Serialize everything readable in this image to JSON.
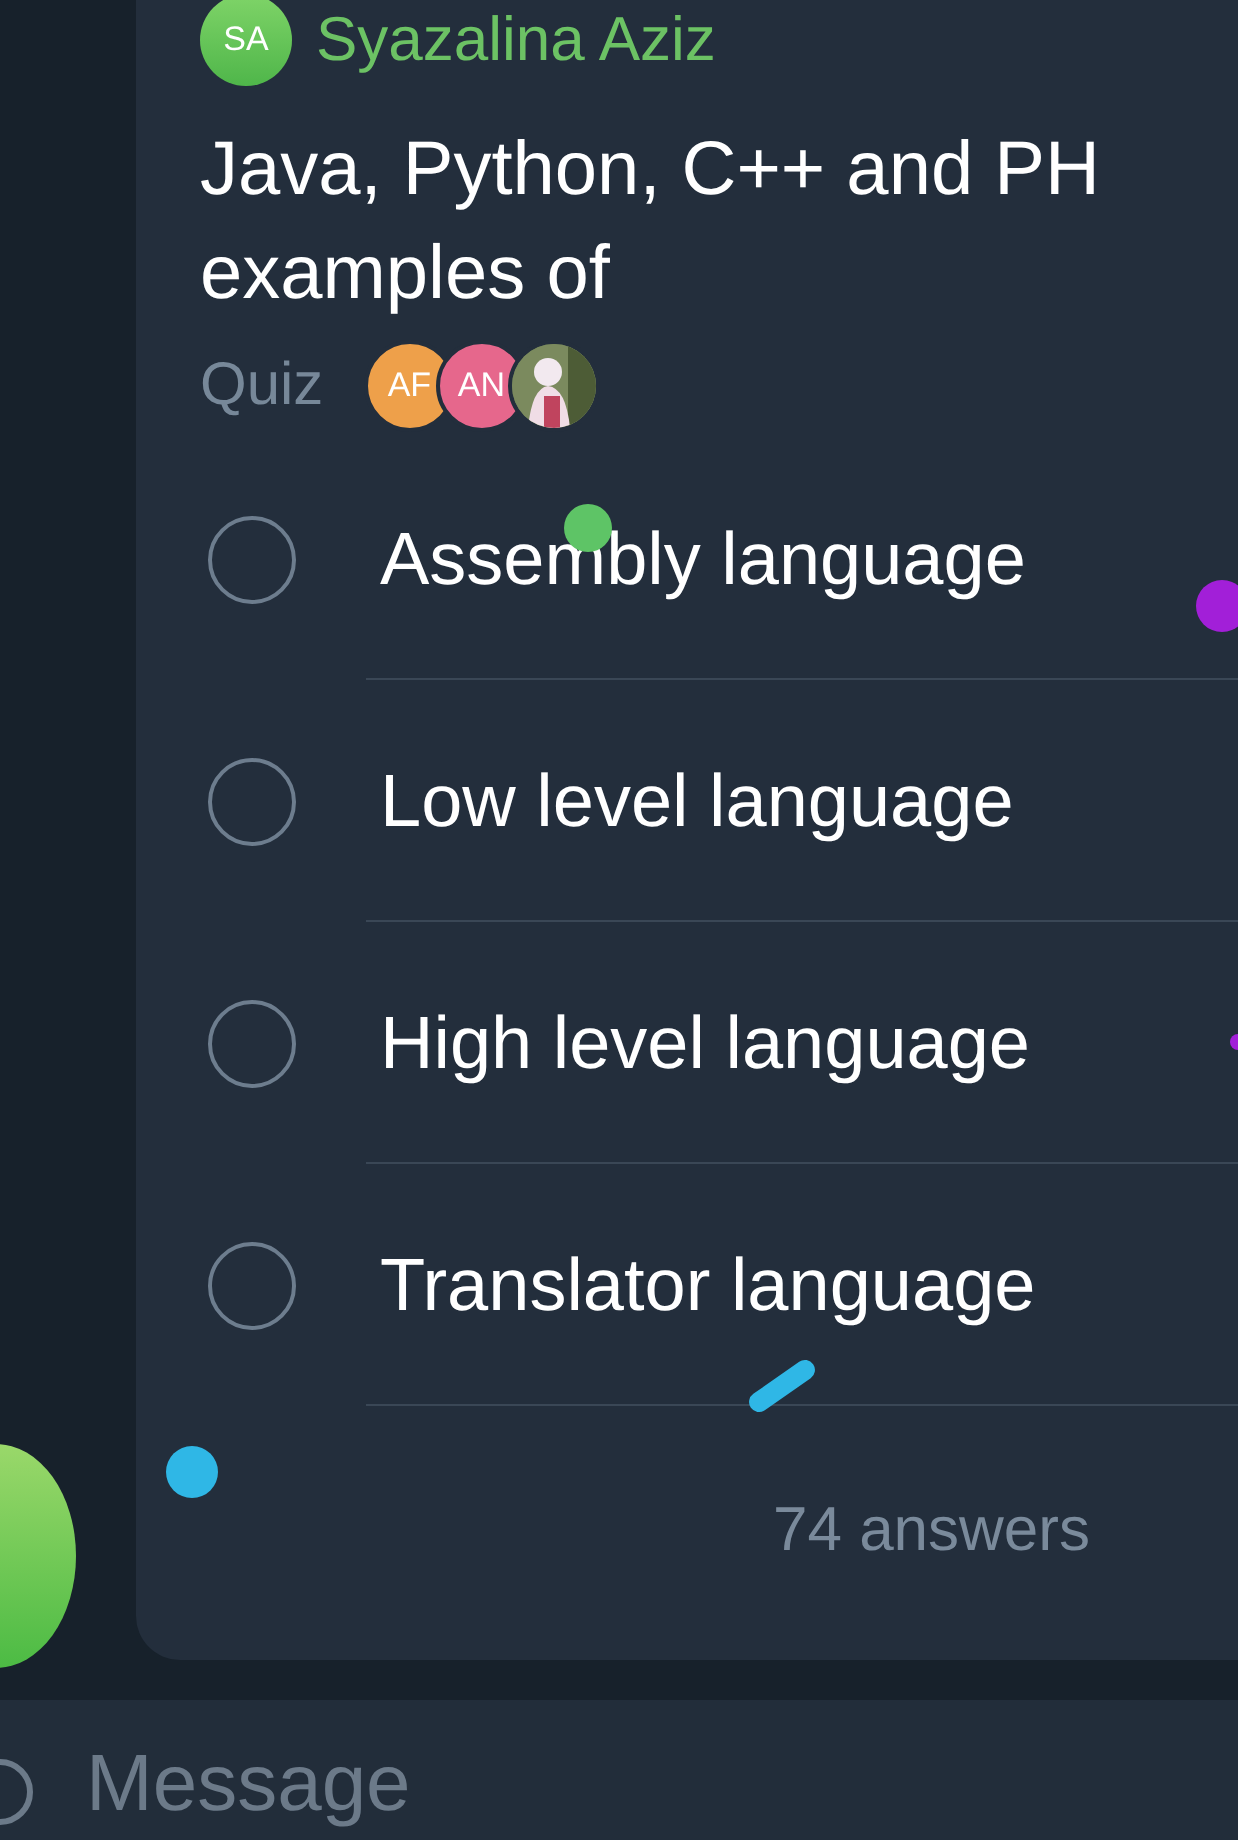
{
  "sender": {
    "initials": "SA",
    "name": "Syazalina Aziz"
  },
  "question": "Java, Python, C++ and PH examples of",
  "poll_type": "Quiz",
  "voters": [
    {
      "kind": "initials",
      "initials": "AF",
      "color": "#eea04a"
    },
    {
      "kind": "initials",
      "initials": "AN",
      "color": "#e6678c"
    },
    {
      "kind": "picture"
    }
  ],
  "options": [
    {
      "text": "Assembly language",
      "selected": false
    },
    {
      "text": "Low level language",
      "selected": false
    },
    {
      "text": "High level language",
      "selected": false
    },
    {
      "text": "Translator language",
      "selected": false
    }
  ],
  "answers": "74 answers",
  "composer": {
    "placeholder": "Message"
  }
}
